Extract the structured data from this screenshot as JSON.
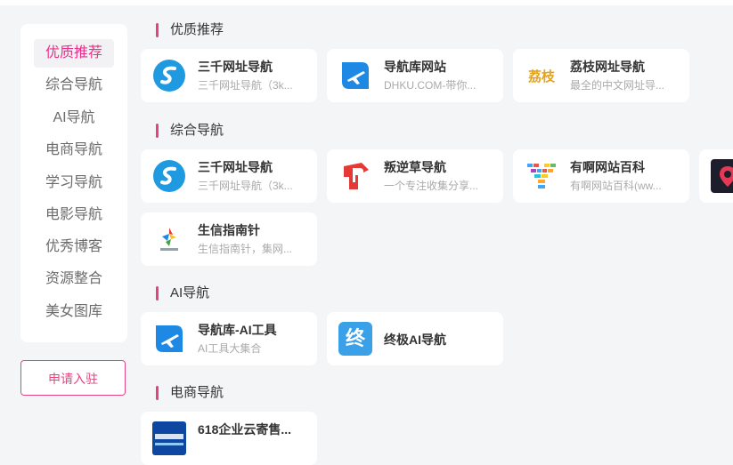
{
  "sidebar": {
    "items": [
      {
        "label": "优质推荐",
        "active": true
      },
      {
        "label": "综合导航"
      },
      {
        "label": "AI导航"
      },
      {
        "label": "电商导航"
      },
      {
        "label": "学习导航"
      },
      {
        "label": "电影导航"
      },
      {
        "label": "优秀博客"
      },
      {
        "label": "资源整合"
      },
      {
        "label": "美女图库"
      }
    ],
    "apply_label": "申请入驻"
  },
  "sections": {
    "featured": {
      "title": "优质推荐",
      "cards": [
        {
          "title": "三千网址导航",
          "desc": "三千网址导航（3k...",
          "icon": "sanqian-s-icon"
        },
        {
          "title": "导航库网站",
          "desc": "DHKU.COM-带你...",
          "icon": "plane-icon"
        },
        {
          "title": "荔枝网址导航",
          "desc": "最全的中文网址导...",
          "icon": "lizhi-logo-icon",
          "icon_text": "荔枝"
        }
      ]
    },
    "general": {
      "title": "综合导航",
      "cards": [
        {
          "title": "三千网址导航",
          "desc": "三千网址导航（3k...",
          "icon": "sanqian-s-icon"
        },
        {
          "title": "叛逆草导航",
          "desc": "一个专注收集分享...",
          "icon": "flag-p-icon"
        },
        {
          "title": "有啊网站百科",
          "desc": "有啊网站百科(ww...",
          "icon": "y-mosaic-icon"
        },
        {
          "title": "",
          "desc": "",
          "icon": "pin-icon"
        },
        {
          "title": "生信指南针",
          "desc": "生信指南针，集网...",
          "icon": "compass-logo-icon"
        }
      ]
    },
    "ai": {
      "title": "AI导航",
      "cards": [
        {
          "title": "导航库-AI工具",
          "desc": "AI工具大集合",
          "icon": "plane-icon"
        },
        {
          "title": "终极AI导航",
          "desc": "",
          "icon": "zhong-char-icon",
          "icon_text": "终"
        }
      ]
    },
    "ecommerce": {
      "title": "电商导航",
      "cards": [
        {
          "title": "618企业云寄售...",
          "desc": "",
          "icon": "cloud-logo-icon"
        }
      ]
    }
  },
  "colors": {
    "accent": "#e6427f",
    "active_text": "#e8308a",
    "background": "#f4f5f7"
  }
}
